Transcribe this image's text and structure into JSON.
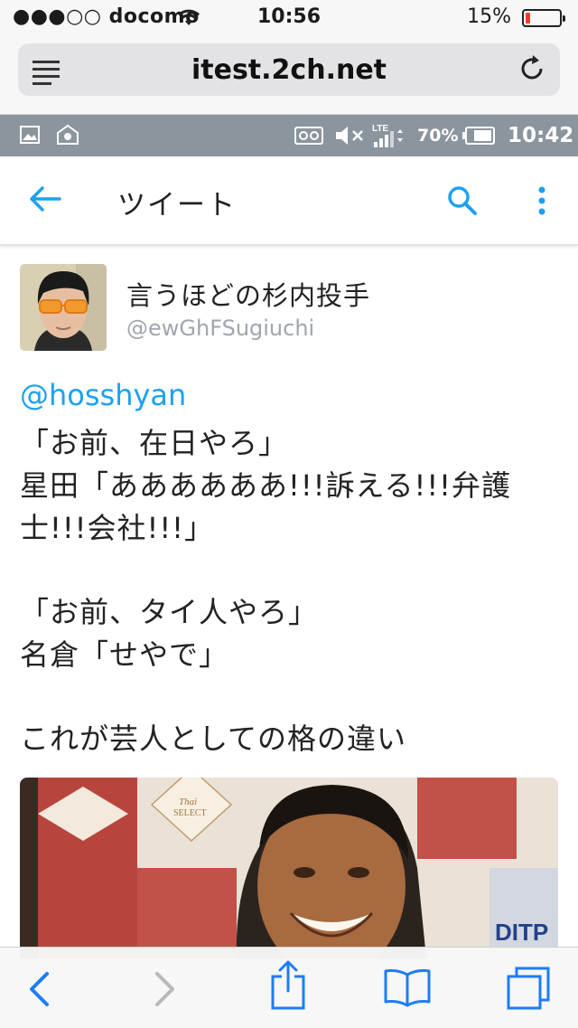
{
  "ios_status": {
    "carrier": "●●●○○ docomo",
    "time": "10:56",
    "battery_percent": "15%",
    "battery_level": 0.15
  },
  "safari": {
    "url": "itest.2ch.net",
    "reader_icon": "reader-list-icon",
    "reload_icon": "reload-icon"
  },
  "android_status": {
    "battery_percent": "70%",
    "clock": "10:42",
    "icons": [
      "image-icon",
      "app-icon",
      "voicemail-icon",
      "mute-icon",
      "lte-signal-icon",
      "battery-icon"
    ]
  },
  "header": {
    "title": "ツイート",
    "back_icon": "back-arrow-icon",
    "search_icon": "search-icon",
    "more_icon": "more-vertical-icon"
  },
  "tweet": {
    "display_name": "言うほどの杉内投手",
    "screen_name": "@ewGhFSugiuchi",
    "mention": "@hosshyan",
    "lines": [
      "「お前、在日やろ」",
      "星田「ああああああ!!!訴える!!!弁護",
      "士!!!会社!!!」",
      "「お前、タイ人やろ」",
      "名倉「せやで」",
      "これが芸人としての格の違い"
    ],
    "photo": {
      "sign_text": "DITP",
      "logo_text_1": "Thai",
      "logo_text_2": "SELECT"
    }
  },
  "toolbar": {
    "icons": [
      "back-chevron-icon",
      "forward-chevron-icon",
      "share-icon",
      "bookmarks-icon",
      "tabs-icon"
    ]
  },
  "colors": {
    "twitter_blue": "#1da1f2",
    "ios_blue": "#1e7cf5",
    "android_bar": "#8b959e",
    "battery_low": "#f23b2e"
  }
}
